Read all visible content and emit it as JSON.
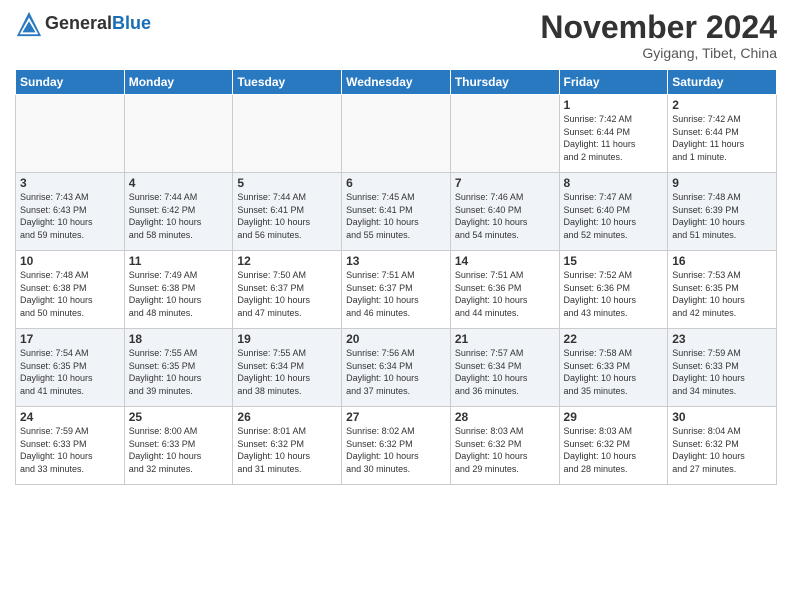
{
  "header": {
    "logo_line1": "General",
    "logo_line2": "Blue",
    "month_title": "November 2024",
    "location": "Gyigang, Tibet, China"
  },
  "days_of_week": [
    "Sunday",
    "Monday",
    "Tuesday",
    "Wednesday",
    "Thursday",
    "Friday",
    "Saturday"
  ],
  "weeks": [
    [
      {
        "day": "",
        "info": "",
        "empty": true
      },
      {
        "day": "",
        "info": "",
        "empty": true
      },
      {
        "day": "",
        "info": "",
        "empty": true
      },
      {
        "day": "",
        "info": "",
        "empty": true
      },
      {
        "day": "",
        "info": "",
        "empty": true
      },
      {
        "day": "1",
        "info": "Sunrise: 7:42 AM\nSunset: 6:44 PM\nDaylight: 11 hours\nand 2 minutes."
      },
      {
        "day": "2",
        "info": "Sunrise: 7:42 AM\nSunset: 6:44 PM\nDaylight: 11 hours\nand 1 minute."
      }
    ],
    [
      {
        "day": "3",
        "info": "Sunrise: 7:43 AM\nSunset: 6:43 PM\nDaylight: 10 hours\nand 59 minutes."
      },
      {
        "day": "4",
        "info": "Sunrise: 7:44 AM\nSunset: 6:42 PM\nDaylight: 10 hours\nand 58 minutes."
      },
      {
        "day": "5",
        "info": "Sunrise: 7:44 AM\nSunset: 6:41 PM\nDaylight: 10 hours\nand 56 minutes."
      },
      {
        "day": "6",
        "info": "Sunrise: 7:45 AM\nSunset: 6:41 PM\nDaylight: 10 hours\nand 55 minutes."
      },
      {
        "day": "7",
        "info": "Sunrise: 7:46 AM\nSunset: 6:40 PM\nDaylight: 10 hours\nand 54 minutes."
      },
      {
        "day": "8",
        "info": "Sunrise: 7:47 AM\nSunset: 6:40 PM\nDaylight: 10 hours\nand 52 minutes."
      },
      {
        "day": "9",
        "info": "Sunrise: 7:48 AM\nSunset: 6:39 PM\nDaylight: 10 hours\nand 51 minutes."
      }
    ],
    [
      {
        "day": "10",
        "info": "Sunrise: 7:48 AM\nSunset: 6:38 PM\nDaylight: 10 hours\nand 50 minutes."
      },
      {
        "day": "11",
        "info": "Sunrise: 7:49 AM\nSunset: 6:38 PM\nDaylight: 10 hours\nand 48 minutes."
      },
      {
        "day": "12",
        "info": "Sunrise: 7:50 AM\nSunset: 6:37 PM\nDaylight: 10 hours\nand 47 minutes."
      },
      {
        "day": "13",
        "info": "Sunrise: 7:51 AM\nSunset: 6:37 PM\nDaylight: 10 hours\nand 46 minutes."
      },
      {
        "day": "14",
        "info": "Sunrise: 7:51 AM\nSunset: 6:36 PM\nDaylight: 10 hours\nand 44 minutes."
      },
      {
        "day": "15",
        "info": "Sunrise: 7:52 AM\nSunset: 6:36 PM\nDaylight: 10 hours\nand 43 minutes."
      },
      {
        "day": "16",
        "info": "Sunrise: 7:53 AM\nSunset: 6:35 PM\nDaylight: 10 hours\nand 42 minutes."
      }
    ],
    [
      {
        "day": "17",
        "info": "Sunrise: 7:54 AM\nSunset: 6:35 PM\nDaylight: 10 hours\nand 41 minutes."
      },
      {
        "day": "18",
        "info": "Sunrise: 7:55 AM\nSunset: 6:35 PM\nDaylight: 10 hours\nand 39 minutes."
      },
      {
        "day": "19",
        "info": "Sunrise: 7:55 AM\nSunset: 6:34 PM\nDaylight: 10 hours\nand 38 minutes."
      },
      {
        "day": "20",
        "info": "Sunrise: 7:56 AM\nSunset: 6:34 PM\nDaylight: 10 hours\nand 37 minutes."
      },
      {
        "day": "21",
        "info": "Sunrise: 7:57 AM\nSunset: 6:34 PM\nDaylight: 10 hours\nand 36 minutes."
      },
      {
        "day": "22",
        "info": "Sunrise: 7:58 AM\nSunset: 6:33 PM\nDaylight: 10 hours\nand 35 minutes."
      },
      {
        "day": "23",
        "info": "Sunrise: 7:59 AM\nSunset: 6:33 PM\nDaylight: 10 hours\nand 34 minutes."
      }
    ],
    [
      {
        "day": "24",
        "info": "Sunrise: 7:59 AM\nSunset: 6:33 PM\nDaylight: 10 hours\nand 33 minutes."
      },
      {
        "day": "25",
        "info": "Sunrise: 8:00 AM\nSunset: 6:33 PM\nDaylight: 10 hours\nand 32 minutes."
      },
      {
        "day": "26",
        "info": "Sunrise: 8:01 AM\nSunset: 6:32 PM\nDaylight: 10 hours\nand 31 minutes."
      },
      {
        "day": "27",
        "info": "Sunrise: 8:02 AM\nSunset: 6:32 PM\nDaylight: 10 hours\nand 30 minutes."
      },
      {
        "day": "28",
        "info": "Sunrise: 8:03 AM\nSunset: 6:32 PM\nDaylight: 10 hours\nand 29 minutes."
      },
      {
        "day": "29",
        "info": "Sunrise: 8:03 AM\nSunset: 6:32 PM\nDaylight: 10 hours\nand 28 minutes."
      },
      {
        "day": "30",
        "info": "Sunrise: 8:04 AM\nSunset: 6:32 PM\nDaylight: 10 hours\nand 27 minutes."
      }
    ]
  ]
}
